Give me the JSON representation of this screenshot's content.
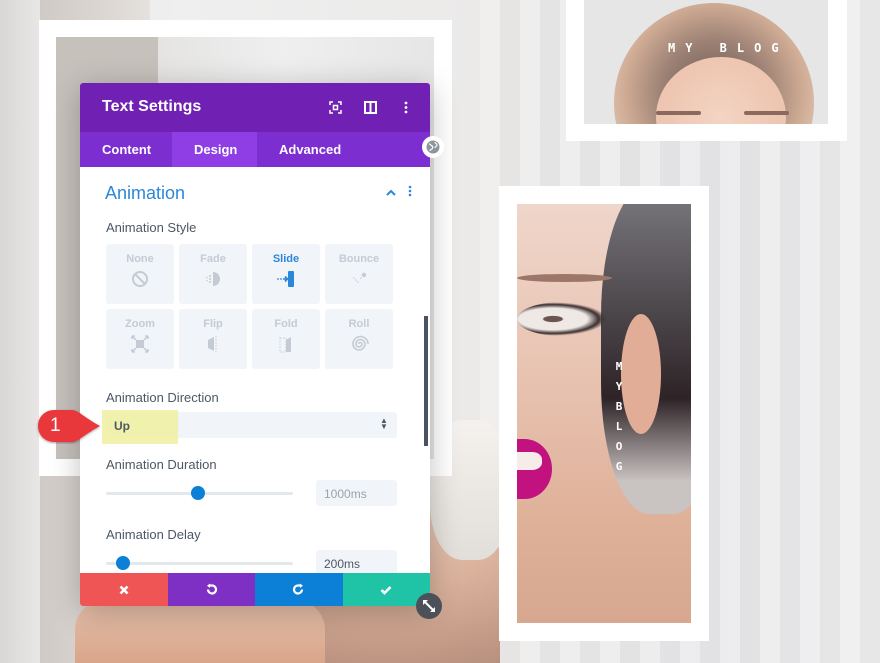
{
  "background": {
    "top_right_card": {
      "text": "MY BLOG"
    },
    "bottom_right_card": {
      "letters": [
        "M",
        "Y",
        "B",
        "L",
        "O",
        "G"
      ]
    }
  },
  "modal": {
    "title": "Text Settings",
    "header_icons": [
      "focus-icon",
      "split-view-icon",
      "more-options-icon"
    ],
    "tabs": [
      {
        "label": "Content",
        "active": false
      },
      {
        "label": "Design",
        "active": true
      },
      {
        "label": "Advanced",
        "active": false
      }
    ],
    "section": {
      "title": "Animation",
      "collapse_icon": "chevron-up-icon",
      "menu_icon": "more-options-icon"
    },
    "animation_style": {
      "label": "Animation Style",
      "options": [
        {
          "label": "None",
          "icon": "none-icon",
          "selected": false
        },
        {
          "label": "Fade",
          "icon": "fade-icon",
          "selected": false
        },
        {
          "label": "Slide",
          "icon": "slide-icon",
          "selected": true
        },
        {
          "label": "Bounce",
          "icon": "bounce-icon",
          "selected": false
        },
        {
          "label": "Zoom",
          "icon": "zoom-icon",
          "selected": false
        },
        {
          "label": "Flip",
          "icon": "flip-icon",
          "selected": false
        },
        {
          "label": "Fold",
          "icon": "fold-icon",
          "selected": false
        },
        {
          "label": "Roll",
          "icon": "roll-icon",
          "selected": false
        }
      ]
    },
    "animation_direction": {
      "label": "Animation Direction",
      "value": "Up"
    },
    "animation_duration": {
      "label": "Animation Duration",
      "value": "1000ms",
      "slider_fraction": 0.49
    },
    "animation_delay": {
      "label": "Animation Delay",
      "value": "200ms",
      "slider_fraction": 0.09
    },
    "footer": {
      "buttons": [
        {
          "name": "discard",
          "icon": "close-icon",
          "color": "#ef5555"
        },
        {
          "name": "undo",
          "icon": "undo-icon",
          "color": "#7e2fc4"
        },
        {
          "name": "redo",
          "icon": "redo-icon",
          "color": "#0c7fd6"
        },
        {
          "name": "save",
          "icon": "check-icon",
          "color": "#1fc4a6"
        }
      ]
    }
  },
  "annotation": {
    "number": "1"
  },
  "colors": {
    "header": "#7020b3",
    "tabs": "#7d2ed0",
    "tab_active": "#8e3ee4",
    "accent_blue": "#2b87da",
    "highlight": "#f0f0a0"
  }
}
